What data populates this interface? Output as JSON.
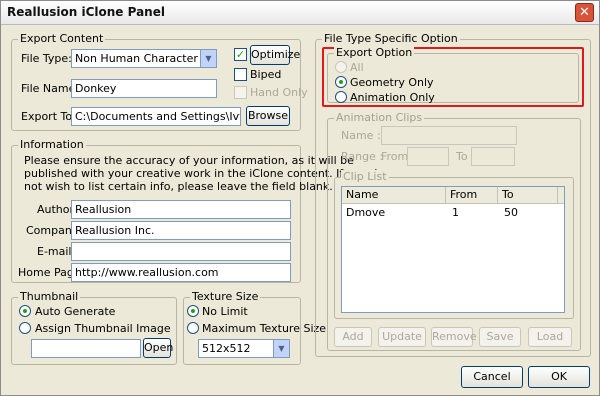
{
  "window": {
    "title": "Reallusion iClone Panel",
    "close_glyph": "✕"
  },
  "export_content": {
    "legend": "Export Content",
    "file_type_label": "File Type:",
    "file_type_value": "Non Human Character",
    "file_name_label": "File Name:",
    "file_name_value": "Donkey",
    "export_to_label": "Export To:",
    "export_to_value": "C:\\Documents and Settings\\Ivy.BEYOUNG",
    "browse_label": "Browse",
    "optimize_label": "Optimize",
    "optimize_checked": true,
    "biped_label": "Biped",
    "biped_checked": false,
    "hand_only_label": "Hand Only",
    "hand_only_checked": false
  },
  "information": {
    "legend": "Information",
    "notice_lines": [
      "Please ensure the accuracy of your information, as it will be",
      "published with your creative work in the iClone content. If you do",
      "not wish to list certain info, please leave the field blank."
    ],
    "author_label": "Author",
    "author_value": "Reallusion",
    "company_label": "Company",
    "company_value": "Reallusion Inc.",
    "email_label": "E-mail",
    "email_value": "",
    "homepage_label": "Home Page",
    "homepage_value": "http://www.reallusion.com"
  },
  "thumbnail": {
    "legend": "Thumbnail",
    "auto_generate_label": "Auto Generate",
    "auto_generate_selected": true,
    "assign_label": "Assign Thumbnail Image",
    "path_value": "",
    "open_label": "Open"
  },
  "texture_size": {
    "legend": "Texture Size",
    "no_limit_label": "No Limit",
    "no_limit_selected": true,
    "max_label": "Maximum Texture Size",
    "max_value": "512x512"
  },
  "file_type_specific": {
    "legend": "File Type Specific Option",
    "export_option": {
      "legend": "Export Option",
      "all_label": "All",
      "geometry_label": "Geometry Only",
      "animation_label": "Animation Only",
      "selected": "Geometry Only"
    },
    "animation_clips": {
      "legend": "Animation Clips",
      "name_label": "Name :",
      "range_label": "Range :",
      "from_label": "From",
      "to_label": "To"
    },
    "clip_list": {
      "legend": "Clip List",
      "columns": [
        "Name",
        "From",
        "To"
      ],
      "rows": [
        {
          "name": "Dmove",
          "from": "1",
          "to": "50"
        }
      ]
    },
    "buttons": {
      "add": "Add",
      "update": "Update",
      "remove": "Remove",
      "save": "Save",
      "load": "Load"
    }
  },
  "footer": {
    "cancel_label": "Cancel",
    "ok_label": "OK"
  },
  "colors": {
    "highlight": "#e01a1a",
    "check_green": "#21a121"
  }
}
